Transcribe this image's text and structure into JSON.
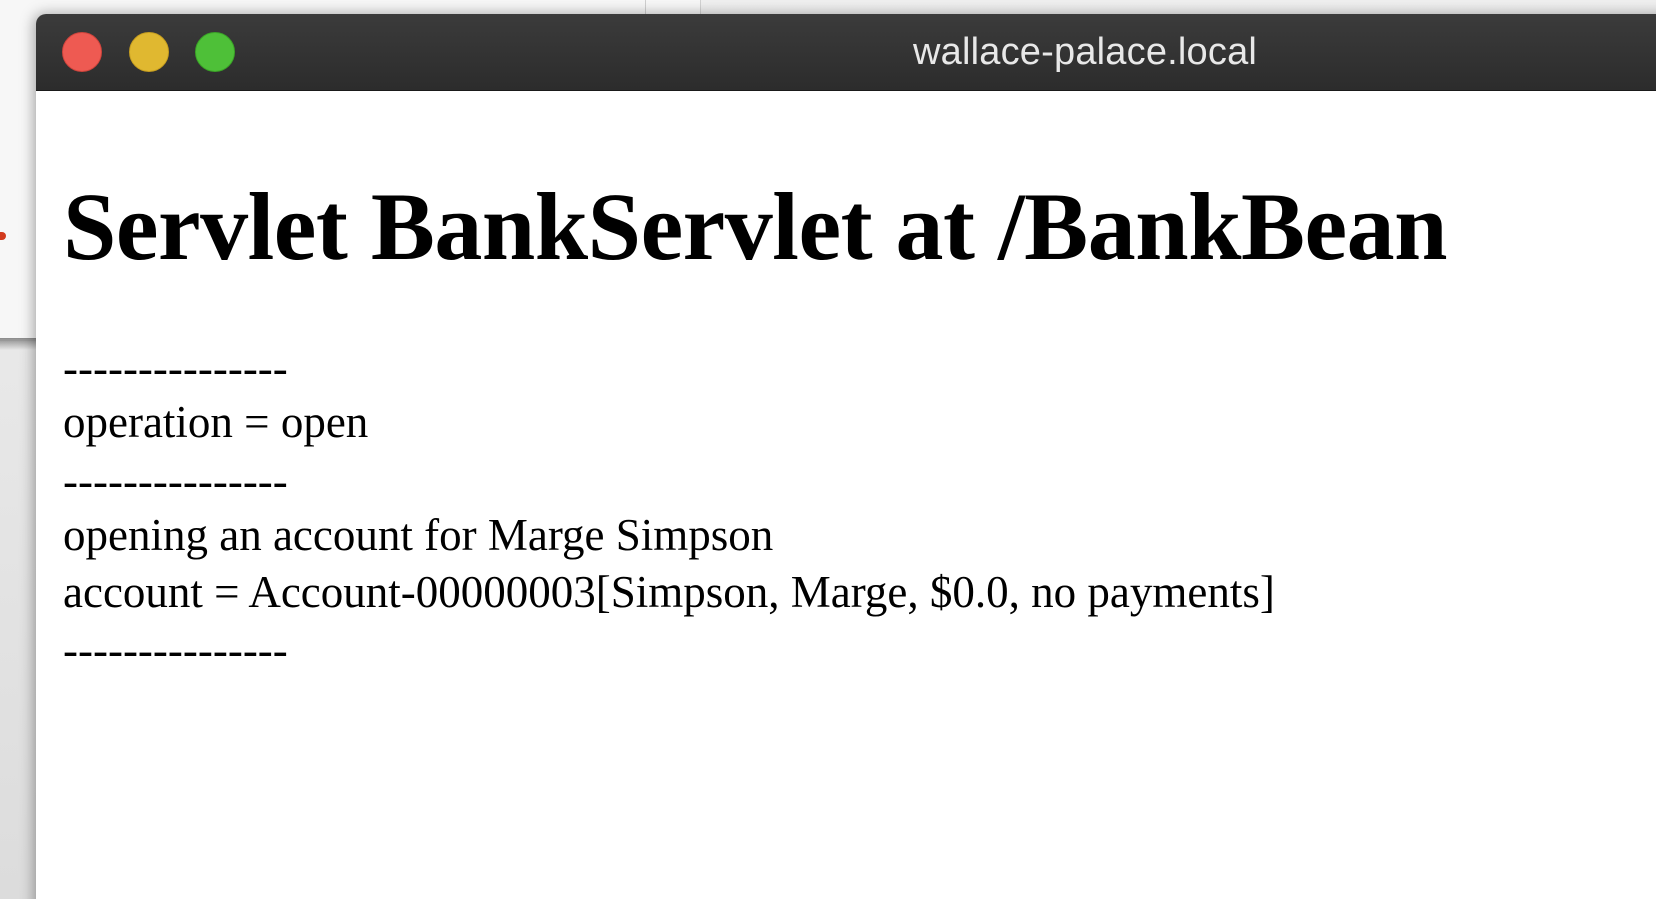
{
  "window": {
    "title": "wallace-palace.local"
  },
  "page": {
    "heading": "Servlet BankServlet at /BankBean",
    "lines": [
      "---------------",
      "operation = open",
      "---------------",
      "opening an account for Marge Simpson",
      "account = Account-00000003[Simpson, Marge, $0.0, no payments]",
      "---------------"
    ]
  },
  "colors": {
    "titlebar": "#333333",
    "close": "#ee5a52",
    "minimize": "#e0b830",
    "maximize": "#4ec038",
    "title_text": "#e8e8e8"
  },
  "icons": {
    "close": "close-button-dot",
    "minimize": "minimize-button-dot",
    "maximize": "maximize-button-dot"
  }
}
